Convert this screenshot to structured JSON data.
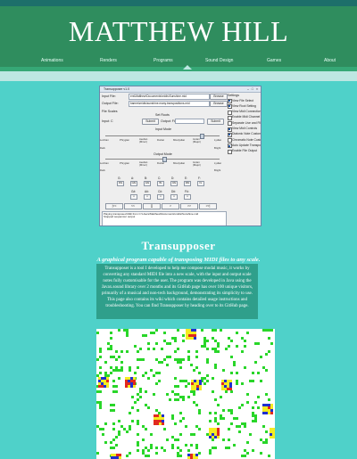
{
  "site": {
    "title": "MATTHEW HILL"
  },
  "nav": {
    "items": [
      "Animations",
      "Renders",
      "Programs",
      "Sound Design",
      "Games",
      "About"
    ],
    "active_index": 2
  },
  "app": {
    "window_title": "Transupposer v1.0",
    "input_file_label": "Input File:",
    "input_file_value": "ers\\Matthew\\Documents\\midis\\Sunshine.mid",
    "output_file_label": "Output File:",
    "output_file_value": "bames\\midis\\sunshine.many.transpositions.mid",
    "browse_label": "Browse",
    "file_scales_label": "File Scales",
    "set_roots_label": "Set Roots",
    "input_label": "Input: C",
    "submit_label": "Submit",
    "output_label": "Output: F#",
    "input_mode_label": "Input Mode",
    "output_mode_label": "Output Mode",
    "modes": [
      "Lochian",
      "Phrygian",
      "Aeolian (Minor)",
      "Dorian",
      "Mixolydian",
      "Ionian (Major)",
      "Lydian"
    ],
    "dark_label": "Dark",
    "bright_label": "Bright",
    "settings_label": "Settings",
    "settings": [
      {
        "label": "View File Select",
        "checked": true
      },
      {
        "label": "View Root Setting",
        "checked": true
      },
      {
        "label": "View Midi Connections",
        "checked": false
      },
      {
        "label": "Enable Midi Channel Selection",
        "checked": false
      },
      {
        "label": "Separate Live and File Scale",
        "checked": false
      },
      {
        "label": "View Midi Controls",
        "checked": true
      },
      {
        "label": "Diatonic Note Customization",
        "checked": true
      },
      {
        "label": "Chromatic Note Customization",
        "checked": false
      },
      {
        "label": "Auto Update Transposer",
        "checked": true
      },
      {
        "label": "Enable File Output",
        "checked": false
      }
    ],
    "key_rows": [
      [
        "G:",
        "A:",
        "B:",
        "C:",
        "D:",
        "E:",
        "F:"
      ],
      [
        "G#:",
        "A#:",
        "C#:",
        "D#:",
        "F#:"
      ]
    ],
    "transport": [
      "|<<",
      "<<",
      "[]",
      ">",
      ">>",
      ">>|"
    ],
    "log_lines": [
      "Playing transposed Midi from C:\\Users\\Matthew\\Documents\\midis\\Sunshine.mid",
      "Stopped sequencer output"
    ]
  },
  "project": {
    "title": "Transupposer",
    "subtitle": "A graphical program capable of transposing MIDI files to any scale.",
    "description": "Transupposer is a tool I developed to help me compose modal music, it works by converting any standard MIDI file into a new scale, with the input and output scale notes fully customisable for the user. The program was developed in Java using the Javax.sound library over 2 months and its GitHub page has over 100 unique visitors, primarily of a musical and non-tech background, demonstrating its simplicity to use. This page also contains its wiki which contains detailed usage instructions and troubleshooting. You can find Transupposer by heading over to its GitHub page."
  },
  "colors": {
    "page_bg": "#4fd1c9",
    "header_bg": "#2f8d5e",
    "desc_bg": "#2f9f8b",
    "grid_green": "#29d629",
    "grid_yellow": "#f4ec22",
    "grid_red": "#e12a1e",
    "grid_blue": "#1f2fd0"
  }
}
